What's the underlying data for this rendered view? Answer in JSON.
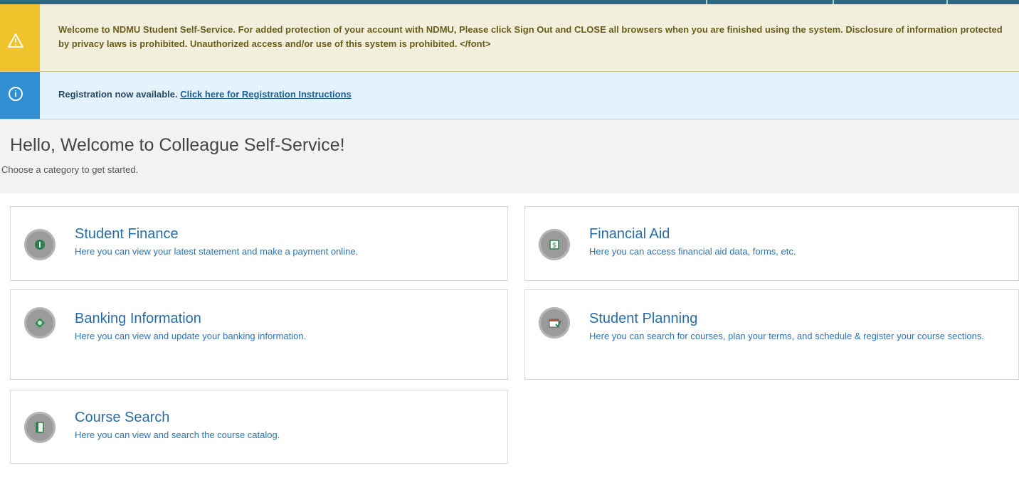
{
  "alerts": {
    "warning": {
      "icon": "warning-icon",
      "text": "Welcome to NDMU Student Self-Service. For added protection of your account with NDMU, Please click Sign Out and CLOSE all browsers when you are finished using the system. Disclosure of information protected by privacy laws is prohibited. Unauthorized access and/or use of this system is prohibited. </font>"
    },
    "info": {
      "icon": "info-icon",
      "text": "Registration now available. ",
      "link_text": "Click here for Registration Instructions"
    }
  },
  "welcome": {
    "title": "Hello, Welcome to Colleague Self-Service!",
    "subtitle": "Choose a category to get started."
  },
  "categories": [
    {
      "title": "Student Finance",
      "description": "Here you can view your latest statement and make a payment online.",
      "icon": "money-icon"
    },
    {
      "title": "Financial Aid",
      "description": "Here you can access financial aid data, forms, etc.",
      "icon": "dollar-document-icon"
    },
    {
      "title": "Banking Information",
      "description": "Here you can view and update your banking information.",
      "icon": "banking-icon"
    },
    {
      "title": "Student Planning",
      "description": "Here you can search for courses, plan your terms, and schedule & register your course sections.",
      "icon": "calendar-check-icon"
    },
    {
      "title": "Course Search",
      "description": "Here you can view and search the course catalog.",
      "icon": "book-icon"
    }
  ],
  "colors": {
    "warning_strip": "#f0c32c",
    "warning_bg": "#f2f0dc",
    "info_strip": "#2f8fd2",
    "info_bg": "#e3f2fb",
    "link": "#2a6da6"
  }
}
